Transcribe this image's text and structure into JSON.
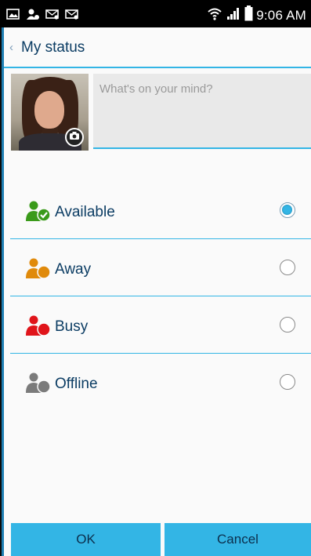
{
  "status_bar": {
    "time": "9:06 AM",
    "notification_icons": [
      "image-notification-icon",
      "contact-notification-icon",
      "mail-notification-icon",
      "mail-notification-icon"
    ],
    "indicators": [
      "wifi-icon",
      "signal-icon",
      "battery-icon"
    ]
  },
  "header": {
    "back_glyph": "‹",
    "title": "My status"
  },
  "composer": {
    "placeholder": "What's on your mind?",
    "value": ""
  },
  "statuses": [
    {
      "label": "Available",
      "color": "#3a9a1a",
      "badge": "check",
      "selected": true
    },
    {
      "label": "Away",
      "color": "#e08a0b",
      "badge": "none",
      "selected": false
    },
    {
      "label": "Busy",
      "color": "#e0141a",
      "badge": "none",
      "selected": false
    },
    {
      "label": "Offline",
      "color": "#7b7b7b",
      "badge": "none",
      "selected": false
    }
  ],
  "actions": {
    "ok_label": "OK",
    "cancel_label": "Cancel"
  },
  "colors": {
    "accent": "#33b5e5",
    "title_text": "#0b3c63"
  }
}
